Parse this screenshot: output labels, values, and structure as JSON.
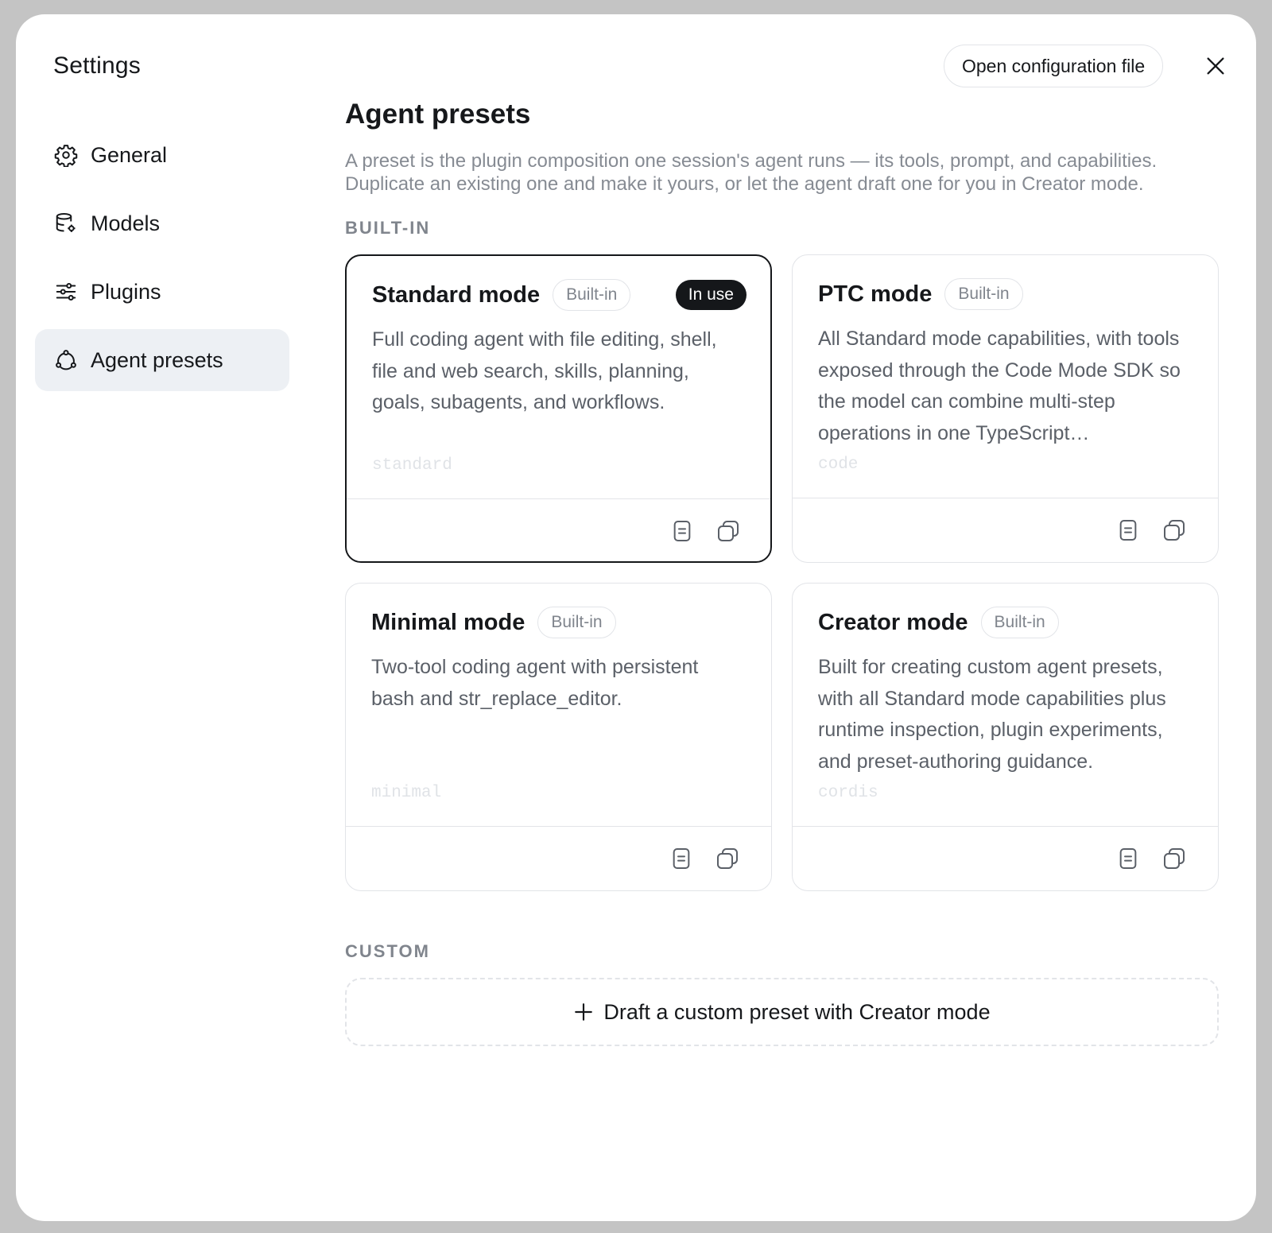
{
  "sidebar": {
    "title": "Settings",
    "items": [
      {
        "label": "General",
        "icon": "gear-icon"
      },
      {
        "label": "Models",
        "icon": "database-gear-icon"
      },
      {
        "label": "Plugins",
        "icon": "sliders-icon"
      },
      {
        "label": "Agent presets",
        "icon": "presets-icon",
        "active": true
      }
    ]
  },
  "header": {
    "open_config_label": "Open configuration file",
    "close_icon": "close-icon"
  },
  "main": {
    "title": "Agent presets",
    "description": "A preset is the plugin composition one session's agent runs — its tools, prompt, and capabilities. Duplicate an existing one and make it yours, or let the agent draft one for you in Creator mode.",
    "builtin_label": "BUILT-IN",
    "custom_label": "CUSTOM",
    "draft_label": "Draft a custom preset with Creator mode",
    "presets": [
      {
        "name": "Standard mode",
        "badge": "Built-in",
        "status": "In use",
        "description": "Full coding agent with file editing, shell, file and web search, skills, planning, goals, subagents, and workflows.",
        "slug": "standard"
      },
      {
        "name": "PTC mode",
        "badge": "Built-in",
        "description": "All Standard mode capabilities, with tools exposed through the Code Mode SDK so the model can combine multi-step operations in one TypeScript…",
        "slug": "code"
      },
      {
        "name": "Minimal mode",
        "badge": "Built-in",
        "description": "Two-tool coding agent with persistent bash and str_replace_editor.",
        "slug": "minimal"
      },
      {
        "name": "Creator mode",
        "badge": "Built-in",
        "description": "Built for creating custom agent presets, with all Standard mode capabilities plus runtime inspection, plugin experiments, and preset-authoring guidance.",
        "slug": "cordis"
      }
    ]
  },
  "colors": {
    "accent_dark": "#15171a",
    "active_nav_bg": "#edf0f4",
    "muted_text": "#868b93",
    "border": "#e2e4e8"
  }
}
